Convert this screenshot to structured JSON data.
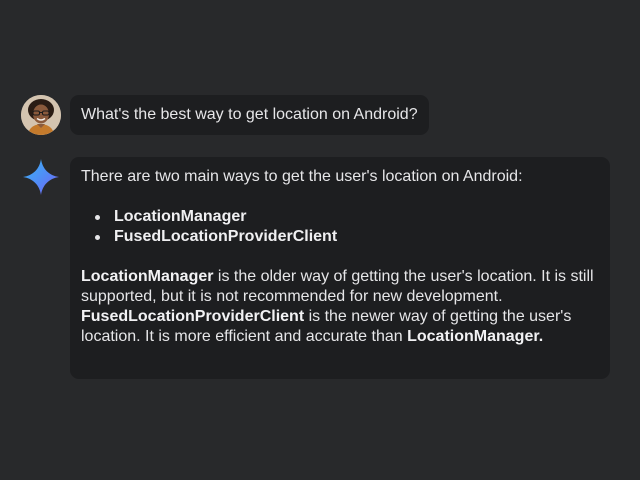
{
  "colors": {
    "background": "#28292b",
    "bubble": "#1d1e20",
    "text": "#e6e6e8",
    "sparkle_gradient": [
      "#4f8ef7",
      "#6a6cf6",
      "#39b6f4"
    ]
  },
  "user_message": {
    "avatar_icon": "user-avatar-photo",
    "text": "What's the best way to get location on Android?"
  },
  "assistant_message": {
    "icon": "gemini-sparkle-icon",
    "intro": "There are two main ways to get the user's location on Android:",
    "options": [
      "LocationManager",
      "FusedLocationProviderClient"
    ],
    "paragraph": {
      "term1": "LocationManager",
      "text1": " is the older way of getting the user's location. It is still supported, but it is not recommended for new development. ",
      "term2": "FusedLocationProviderClient",
      "text2": " is the newer way of getting the user's location. It is more efficient and accurate than ",
      "term3": "LocationManager.",
      "text3": ""
    }
  }
}
